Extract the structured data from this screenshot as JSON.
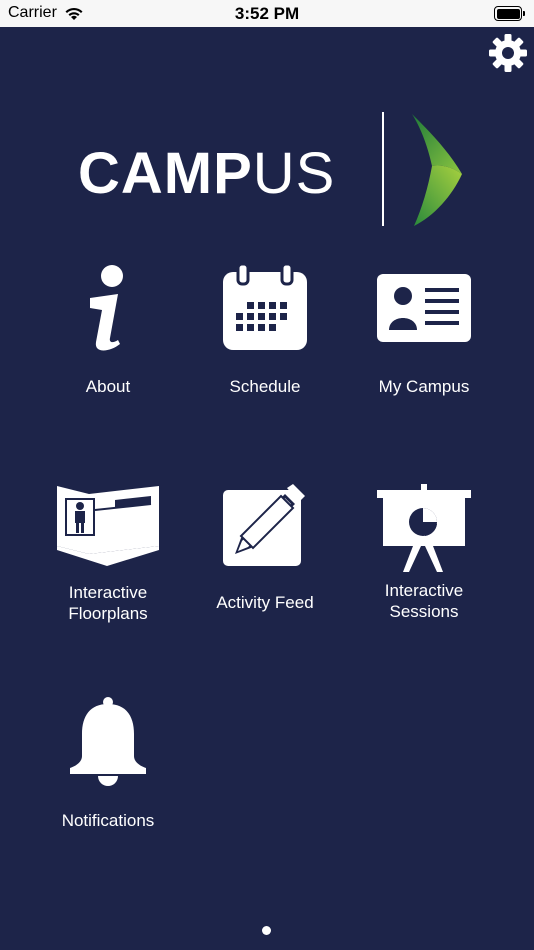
{
  "status_bar": {
    "carrier": "Carrier",
    "time": "3:52 PM"
  },
  "header": {
    "settings_icon": "gear-icon"
  },
  "logo": {
    "text_bold": "CAMP",
    "text_light": "US"
  },
  "tiles": [
    {
      "label_line1": "About",
      "label_line2": "",
      "icon": "info-icon"
    },
    {
      "label_line1": "Schedule",
      "label_line2": "",
      "icon": "calendar-icon"
    },
    {
      "label_line1": "My Campus",
      "label_line2": "",
      "icon": "id-card-icon"
    },
    {
      "label_line1": "Interactive",
      "label_line2": "Floorplans",
      "icon": "floorplan-icon"
    },
    {
      "label_line1": "Activity Feed",
      "label_line2": "",
      "icon": "edit-icon"
    },
    {
      "label_line1": "Interactive",
      "label_line2": "Sessions",
      "icon": "presentation-icon"
    },
    {
      "label_line1": "Notifications",
      "label_line2": "",
      "icon": "bell-icon"
    }
  ],
  "colors": {
    "background": "#1d2449",
    "foreground": "#ffffff",
    "logo_green_dark": "#2e8b3e",
    "logo_green_light": "#9ccb3b"
  },
  "pager": {
    "current_page": 1
  }
}
